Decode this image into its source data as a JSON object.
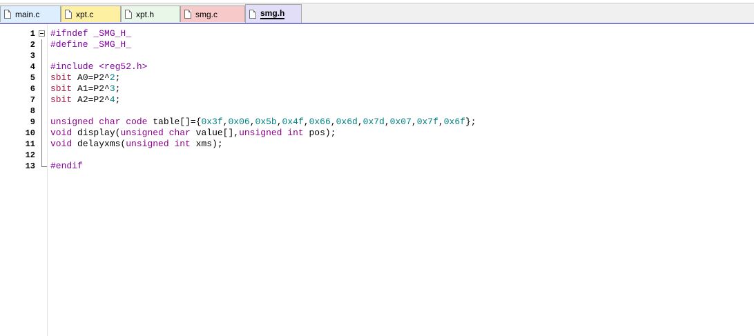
{
  "tabs": [
    {
      "label": "main.c",
      "color": "#ddeeff"
    },
    {
      "label": "xpt.c",
      "color": "#fdf0a0"
    },
    {
      "label": "xpt.h",
      "color": "#e8f7e8"
    },
    {
      "label": "smg.c",
      "color": "#f7c9c9"
    },
    {
      "label": "smg.h",
      "color": "#e3def7",
      "active": true
    }
  ],
  "editor": {
    "lines": [
      {
        "n": "1",
        "segs": [
          {
            "t": "#ifndef _SMG_H_",
            "c": "pp"
          }
        ]
      },
      {
        "n": "2",
        "segs": [
          {
            "t": "#define _SMG_H_",
            "c": "pp"
          }
        ]
      },
      {
        "n": "3",
        "segs": []
      },
      {
        "n": "4",
        "segs": [
          {
            "t": "#include <reg52.h>",
            "c": "pp"
          }
        ]
      },
      {
        "n": "5",
        "segs": [
          {
            "t": "sbit",
            "c": "kwred"
          },
          {
            "t": " A0=P2^",
            "c": "def"
          },
          {
            "t": "2",
            "c": "num"
          },
          {
            "t": ";",
            "c": "def"
          }
        ]
      },
      {
        "n": "6",
        "segs": [
          {
            "t": "sbit",
            "c": "kwred"
          },
          {
            "t": " A1=P2^",
            "c": "def"
          },
          {
            "t": "3",
            "c": "num"
          },
          {
            "t": ";",
            "c": "def"
          }
        ]
      },
      {
        "n": "7",
        "segs": [
          {
            "t": "sbit",
            "c": "kwred"
          },
          {
            "t": " A2=P2^",
            "c": "def"
          },
          {
            "t": "4",
            "c": "num"
          },
          {
            "t": ";",
            "c": "def"
          }
        ]
      },
      {
        "n": "8",
        "segs": []
      },
      {
        "n": "9",
        "segs": [
          {
            "t": "unsigned char code",
            "c": "kw"
          },
          {
            "t": " table[]={",
            "c": "def"
          },
          {
            "t": "0x3f",
            "c": "num"
          },
          {
            "t": ",",
            "c": "def"
          },
          {
            "t": "0x06",
            "c": "num"
          },
          {
            "t": ",",
            "c": "def"
          },
          {
            "t": "0x5b",
            "c": "num"
          },
          {
            "t": ",",
            "c": "def"
          },
          {
            "t": "0x4f",
            "c": "num"
          },
          {
            "t": ",",
            "c": "def"
          },
          {
            "t": "0x66",
            "c": "num"
          },
          {
            "t": ",",
            "c": "def"
          },
          {
            "t": "0x6d",
            "c": "num"
          },
          {
            "t": ",",
            "c": "def"
          },
          {
            "t": "0x7d",
            "c": "num"
          },
          {
            "t": ",",
            "c": "def"
          },
          {
            "t": "0x07",
            "c": "num"
          },
          {
            "t": ",",
            "c": "def"
          },
          {
            "t": "0x7f",
            "c": "num"
          },
          {
            "t": ",",
            "c": "def"
          },
          {
            "t": "0x6f",
            "c": "num"
          },
          {
            "t": "};",
            "c": "def"
          }
        ]
      },
      {
        "n": "10",
        "segs": [
          {
            "t": "void",
            "c": "kw"
          },
          {
            "t": " display(",
            "c": "def"
          },
          {
            "t": "unsigned char",
            "c": "kw"
          },
          {
            "t": " value[],",
            "c": "def"
          },
          {
            "t": "unsigned int",
            "c": "kw"
          },
          {
            "t": " pos);",
            "c": "def"
          }
        ]
      },
      {
        "n": "11",
        "segs": [
          {
            "t": "void",
            "c": "kw"
          },
          {
            "t": " delayxms(",
            "c": "def"
          },
          {
            "t": "unsigned int",
            "c": "kw"
          },
          {
            "t": " xms);",
            "c": "def"
          }
        ]
      },
      {
        "n": "12",
        "segs": []
      },
      {
        "n": "13",
        "segs": [
          {
            "t": "#endif",
            "c": "pp"
          }
        ]
      }
    ]
  }
}
